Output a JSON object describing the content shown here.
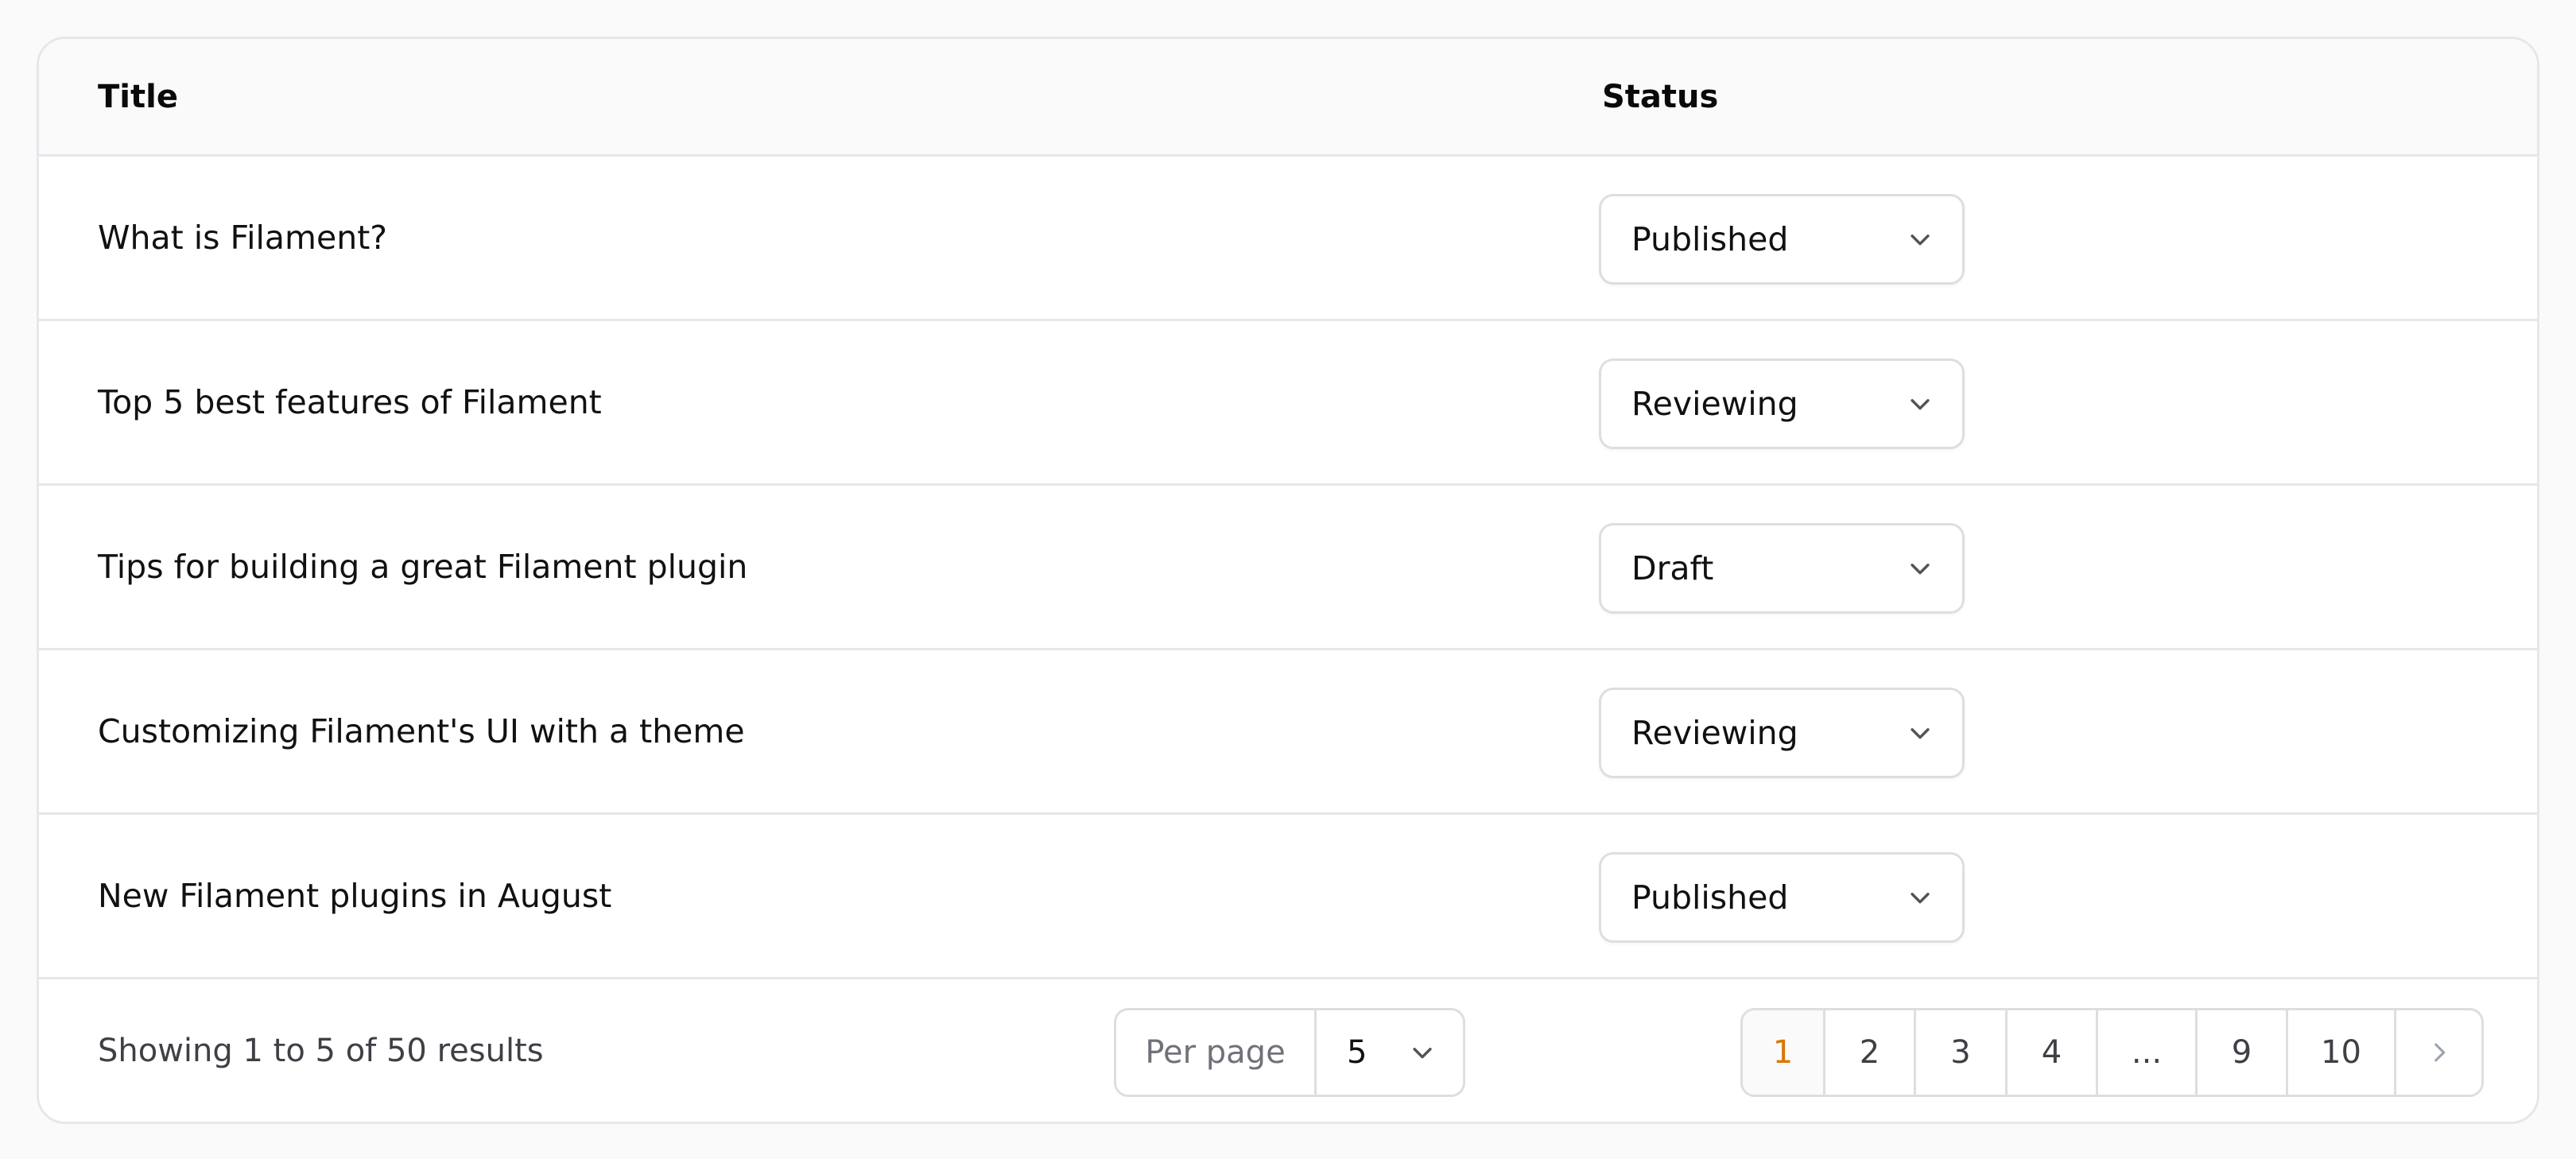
{
  "table": {
    "headers": {
      "title": "Title",
      "status": "Status"
    },
    "rows": [
      {
        "title": "What is Filament?",
        "status": "Published"
      },
      {
        "title": "Top 5 best features of Filament",
        "status": "Reviewing"
      },
      {
        "title": "Tips for building a great Filament plugin",
        "status": "Draft"
      },
      {
        "title": "Customizing Filament's UI with a theme",
        "status": "Reviewing"
      },
      {
        "title": "New Filament plugins in August",
        "status": "Published"
      }
    ]
  },
  "footer": {
    "results_text": "Showing 1 to 5 of 50 results",
    "per_page_label": "Per page",
    "per_page_value": "5",
    "pages": [
      "1",
      "2",
      "3",
      "4",
      "...",
      "9",
      "10"
    ],
    "active_page": "1"
  },
  "colors": {
    "accent": "#d97706",
    "border": "#e5e7eb",
    "header_bg": "#fafafa"
  },
  "icons": {
    "select_chevron": "chevron-down-icon",
    "next_page": "chevron-right-icon"
  }
}
